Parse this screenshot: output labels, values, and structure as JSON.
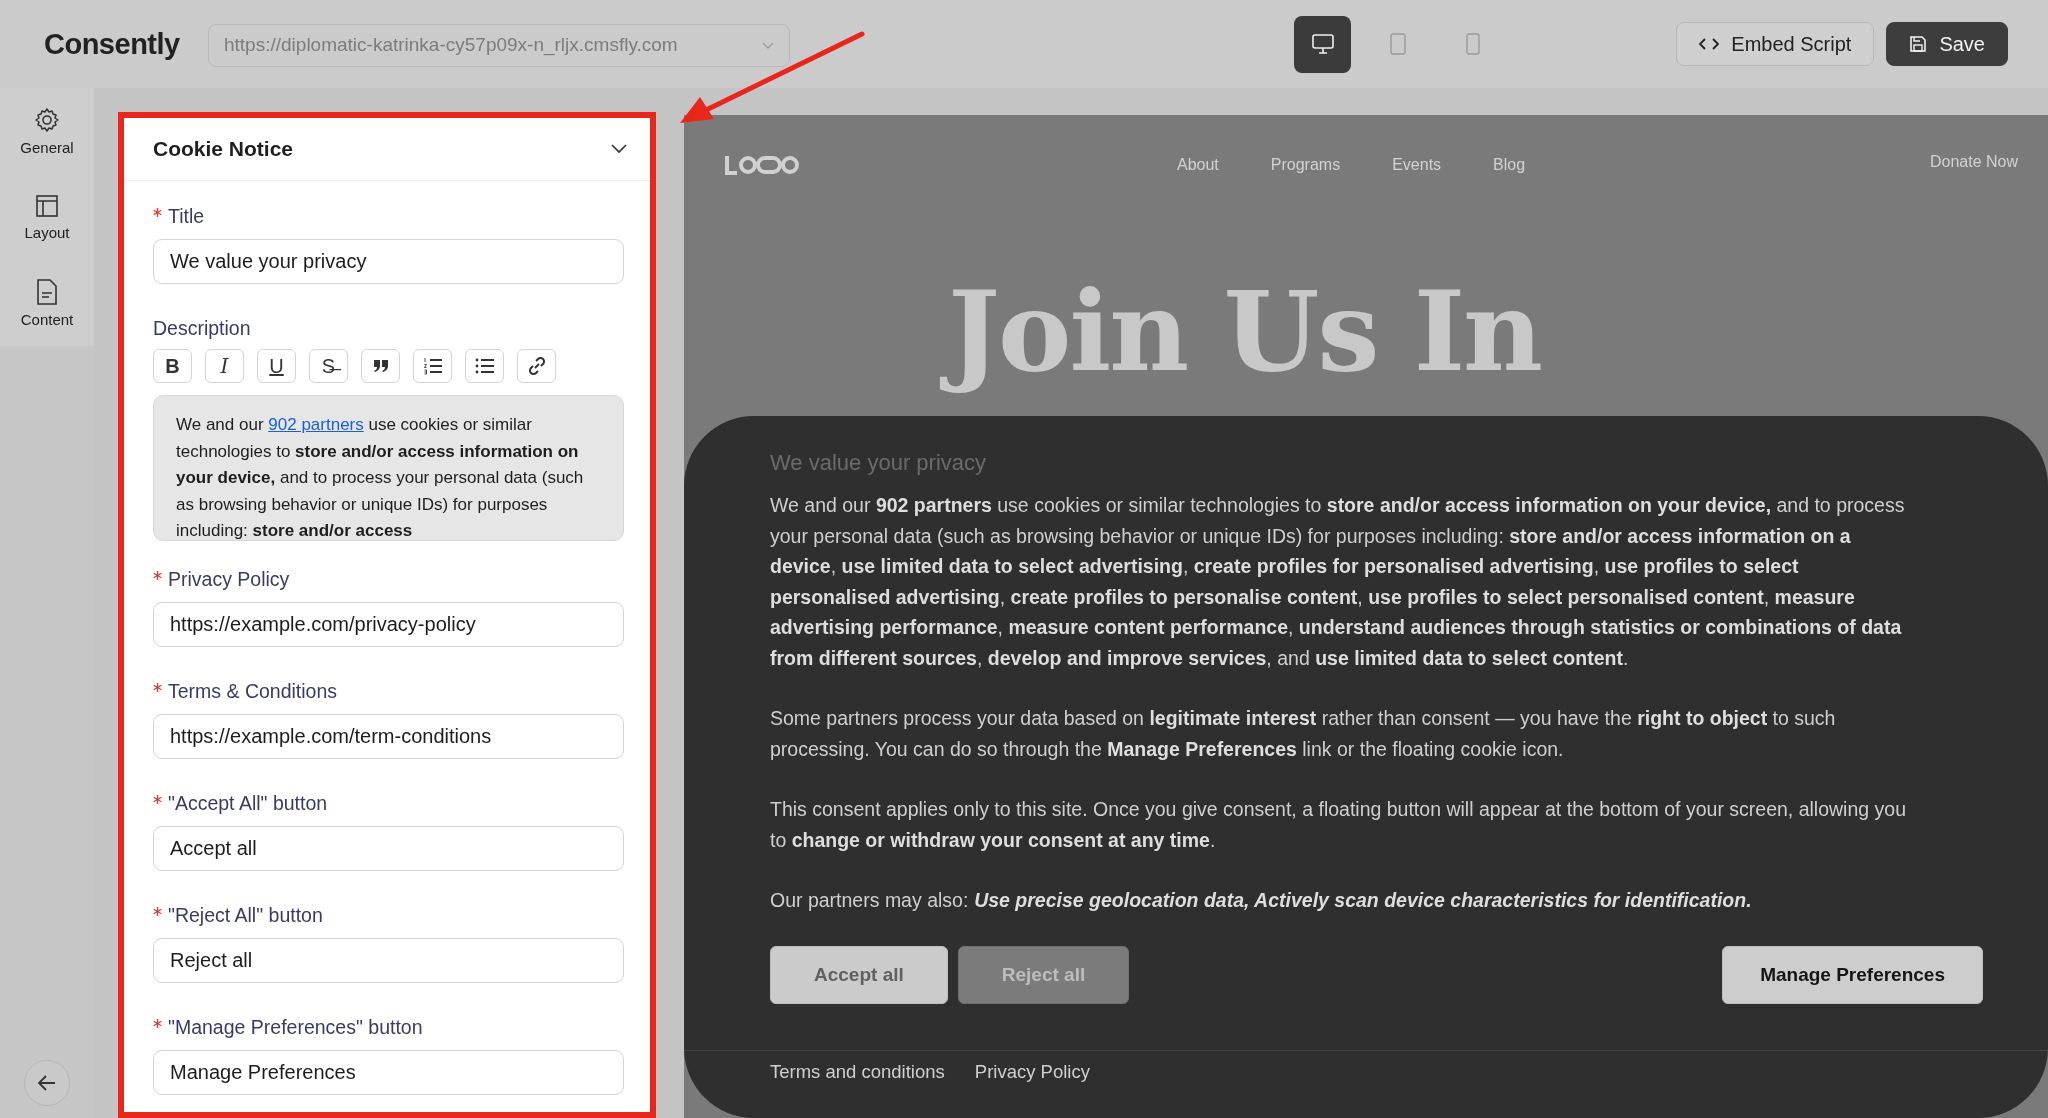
{
  "topbar": {
    "logo": "Consently",
    "url_select": "https://diplomatic-katrinka-cy57p09x-n_rljx.cmsfly.com",
    "devices": [
      {
        "kind": "desktop",
        "selected": true
      },
      {
        "kind": "tablet",
        "selected": false
      },
      {
        "kind": "mobile",
        "selected": false
      }
    ],
    "actions": [
      {
        "kind": "embed",
        "label": "Embed Script"
      },
      {
        "kind": "save",
        "label": "Save"
      }
    ]
  },
  "sidebar": {
    "items": [
      {
        "kind": "general",
        "label": "General"
      },
      {
        "kind": "layout",
        "label": "Layout"
      },
      {
        "kind": "content",
        "label": "Content"
      }
    ]
  },
  "panel": {
    "title": "Cookie Notice",
    "expanded": true,
    "fields": [
      {
        "kind": "text",
        "label": "Title",
        "required": true,
        "value": "We value your privacy"
      },
      {
        "kind": "richtext",
        "label": "Description",
        "required": false,
        "toolbar": [
          {
            "kind": "bold",
            "label": "B"
          },
          {
            "kind": "italic",
            "label": "I"
          },
          {
            "kind": "underline",
            "label": "U"
          },
          {
            "kind": "strike",
            "label": "S̶"
          },
          {
            "kind": "quote"
          },
          {
            "kind": "ordered-list"
          },
          {
            "kind": "bullet-list"
          },
          {
            "kind": "link"
          }
        ],
        "text_before": "We and our",
        "link": "902 partners",
        "text_after": "use cookies or similar technologies to **store and/or access information on your device,** and to process your personal data (such as browsing behavior or unique IDs) for purposes including: **store and/or access**"
      },
      {
        "kind": "text",
        "label": "Privacy Policy",
        "required": true,
        "value": "https://example.com/privacy-policy"
      },
      {
        "kind": "text",
        "label": "Terms & Conditions",
        "required": true,
        "value": "https://example.com/term-conditions"
      },
      {
        "kind": "text",
        "label": "\"Accept All\" button",
        "required": true,
        "value": "Accept all"
      },
      {
        "kind": "text",
        "label": "\"Reject All\" button",
        "required": true,
        "value": "Reject all"
      },
      {
        "kind": "text",
        "label": "\"Manage Preferences\" button",
        "required": true,
        "value": "Manage Preferences"
      }
    ]
  },
  "preview": {
    "nav": [
      "About",
      "Programs",
      "Events",
      "Blog"
    ],
    "donate": "Donate Now",
    "hero": "Join Us In",
    "banner": {
      "title": "We value your privacy",
      "paragraphs": [
        {
          "text": "We and our **902 partners** use cookies or similar technologies to **store and/or access information on your device,** and to process your personal data (such as browsing behavior or unique IDs) for purposes including: **store and/or access information on a device**, **use limited data to select advertising**, **create profiles for personalised advertising**, **use profiles to select personalised advertising**, **create profiles to personalise content**, **use profiles to select personalised content**, **measure advertising performance**, **measure content performance**, **understand audiences through statistics or combinations of data from different sources**, **develop and improve services**, and **use limited data to select content**."
        },
        {
          "text": "Some partners process your data based on **legitimate interest** rather than consent — you have the **right to object** to such processing. You can do so through the **Manage Preferences** link or the floating cookie icon."
        },
        {
          "text": "This consent applies only to this site. Once you give consent, a floating button will appear at the bottom of your screen, allowing you to **change or withdraw your consent at any time**."
        },
        {
          "text": "Our partners may also:",
          "emphasis": "Use precise geolocation data, Actively scan device characteristics for identification."
        }
      ],
      "buttons": [
        {
          "kind": "accept",
          "label": "Accept all"
        },
        {
          "kind": "reject",
          "label": "Reject all"
        },
        {
          "kind": "manage",
          "label": "Manage Preferences"
        }
      ],
      "footer_links": [
        "Terms and conditions",
        "Privacy Policy"
      ]
    }
  }
}
